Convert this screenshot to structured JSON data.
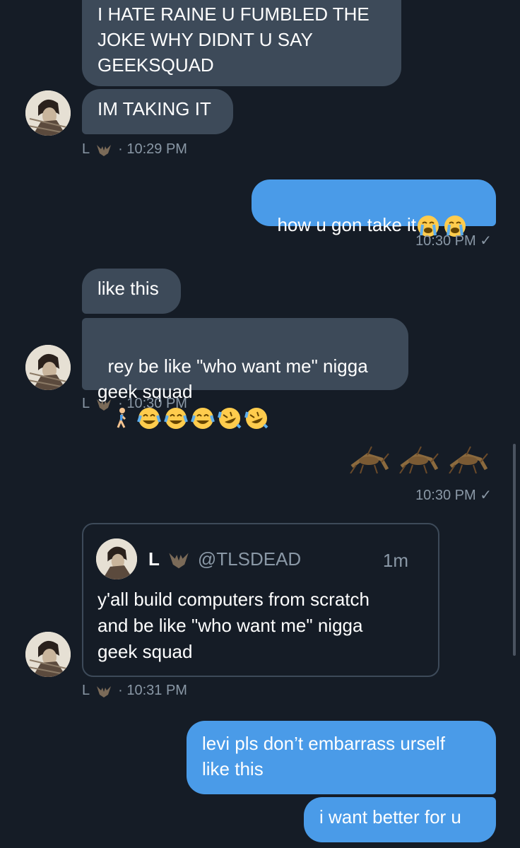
{
  "messages": [
    {
      "id": "m1",
      "direction": "incoming",
      "text": "I HATE RAINE U FUMBLED THE\nJOKE WHY DIDNT U SAY\nGEEKSQUAD"
    },
    {
      "id": "m2",
      "direction": "incoming",
      "text": "IM TAKING IT"
    },
    {
      "id": "m3",
      "direction": "outgoing",
      "text": "how u gon take it",
      "emojis": [
        "loudly-crying-face",
        "loudly-crying-face"
      ]
    },
    {
      "id": "m4",
      "direction": "incoming",
      "text": "like this"
    },
    {
      "id": "m5",
      "direction": "incoming",
      "text": "rey be like \"who want me\" nigga\ngeek squad",
      "emojis": [
        "person-walking",
        "face-with-tears-of-joy",
        "face-with-tears-of-joy",
        "face-with-tears-of-joy",
        "rolling-on-the-floor-laughing",
        "rolling-on-the-floor-laughing"
      ]
    },
    {
      "id": "m6",
      "direction": "outgoing",
      "emojis": [
        "cricket",
        "cricket",
        "cricket"
      ]
    },
    {
      "id": "m7",
      "direction": "outgoing",
      "text": "levi pls don’t embarrass urself\nlike this"
    },
    {
      "id": "m8",
      "direction": "outgoing",
      "text": "i want better for u"
    }
  ],
  "meta": {
    "g1": {
      "sender": "L",
      "time": "· 10:29 PM"
    },
    "o1": {
      "time": "10:30 PM"
    },
    "g2": {
      "sender": "L",
      "time": "· 10:30 PM"
    },
    "o2": {
      "time": "10:30 PM"
    },
    "g3": {
      "sender": "L",
      "time": "· 10:31 PM"
    }
  },
  "quoted_tweet": {
    "name": "L",
    "handle": "@TLSDEAD",
    "age": "1m",
    "text": "y'all build computers from scratch\nand be like \"who want me\" nigga\ngeek squad"
  },
  "icons": {
    "read_receipt": "checkmark-icon",
    "sender_badge": "bat-icon"
  },
  "colors": {
    "background": "#151c26",
    "incoming_bubble": "#3d4a59",
    "outgoing_bubble": "#4a9be8",
    "meta_text": "#8a98a6"
  }
}
